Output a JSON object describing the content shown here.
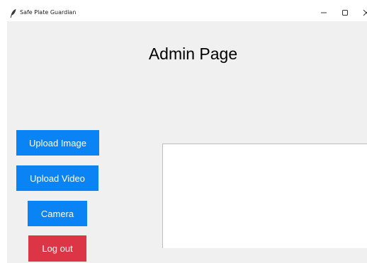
{
  "window": {
    "title": "Safe Plate Guardian",
    "icon": "feather-icon",
    "controls": {
      "minimize_icon": "minimize-icon",
      "maximize_icon": "maximize-icon",
      "close_icon": "close-icon"
    }
  },
  "main": {
    "title": "Admin Page"
  },
  "sidebar": {
    "upload_image_label": "Upload Image",
    "upload_video_label": "Upload Video",
    "camera_label": "Camera",
    "logout_label": "Log out"
  },
  "colors": {
    "primary_button": "#0a84f5",
    "danger_button": "#dc3545",
    "window_background": "#f0f0f0",
    "preview_background": "#ffffff"
  }
}
